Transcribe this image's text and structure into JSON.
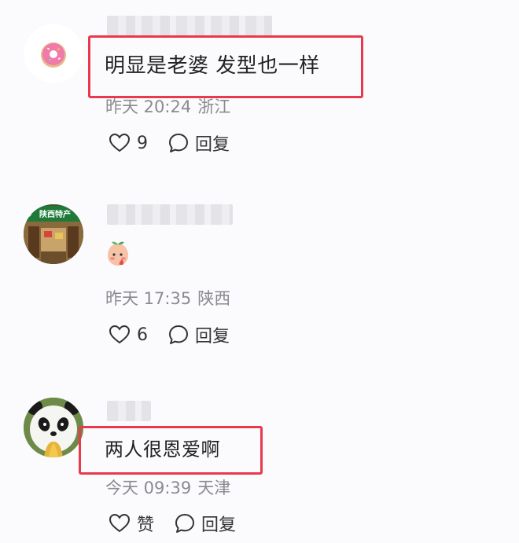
{
  "comments": [
    {
      "text": "明显是老婆 发型也一样",
      "time": "昨天 20:24",
      "location": "浙江",
      "like_count": "9",
      "reply_label": "回复",
      "highlighted": true
    },
    {
      "text": "",
      "time": "昨天 17:35",
      "location": "陕西",
      "like_count": "6",
      "reply_label": "回复",
      "highlighted": false,
      "avatar_sign_text": "陕西特产"
    },
    {
      "text": "两人很恩爱啊",
      "time": "今天 09:39",
      "location": "天津",
      "like_count": "赞",
      "reply_label": "回复",
      "highlighted": true
    }
  ],
  "colors": {
    "highlight": "#e8394d",
    "meta_text": "#8a8a90",
    "icon": "#333333",
    "donut_frosting": "#f07aa8"
  },
  "icons": {
    "like": "heart-outline-icon",
    "reply": "speech-bubble-icon",
    "sticker": "peach-face-sticker"
  }
}
